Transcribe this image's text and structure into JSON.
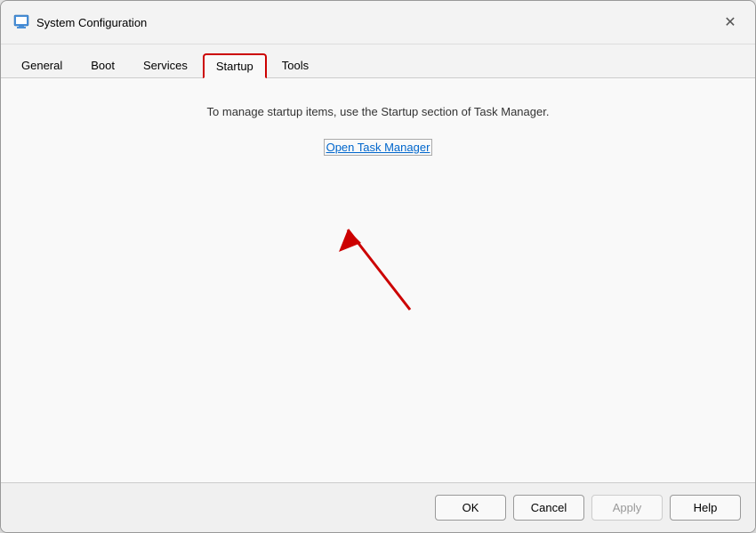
{
  "window": {
    "title": "System Configuration",
    "icon_label": "system-config-icon"
  },
  "tabs": [
    {
      "label": "General",
      "active": false
    },
    {
      "label": "Boot",
      "active": false
    },
    {
      "label": "Services",
      "active": false
    },
    {
      "label": "Startup",
      "active": true
    },
    {
      "label": "Tools",
      "active": false
    }
  ],
  "content": {
    "info_text": "To manage startup items, use the Startup section of Task Manager.",
    "link_text": "Open Task Manager"
  },
  "footer": {
    "ok_label": "OK",
    "cancel_label": "Cancel",
    "apply_label": "Apply",
    "help_label": "Help"
  },
  "close_button_char": "✕"
}
